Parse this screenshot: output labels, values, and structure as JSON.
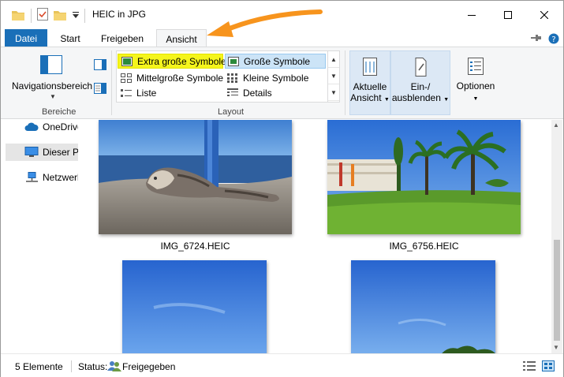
{
  "window": {
    "title": "HEIC in JPG"
  },
  "tabs": [
    {
      "label": "Datei"
    },
    {
      "label": "Start"
    },
    {
      "label": "Freigeben"
    },
    {
      "label": "Ansicht"
    }
  ],
  "ribbon": {
    "panes": {
      "navigation_label": "Navigationsbereich",
      "group_label": "Bereiche"
    },
    "layout": {
      "group_label": "Layout",
      "options": [
        {
          "label": "Extra große Symbole",
          "icon": "extra-large-icons-icon"
        },
        {
          "label": "Große Symbole",
          "icon": "large-icons-icon"
        },
        {
          "label": "Mittelgroße Symbole",
          "icon": "medium-icons-icon"
        },
        {
          "label": "Kleine Symbole",
          "icon": "small-icons-icon"
        },
        {
          "label": "Liste",
          "icon": "list-icon"
        },
        {
          "label": "Details",
          "icon": "details-icon"
        }
      ],
      "highlight_color": "#f5f51c",
      "selected_color": "#cce4f7"
    },
    "current_view": {
      "line1": "Aktuelle",
      "line2": "Ansicht"
    },
    "show_hide": {
      "line1": "Ein-/",
      "line2": "ausblenden"
    },
    "options": {
      "label": "Optionen"
    }
  },
  "nav": {
    "items": [
      {
        "label": "OneDrive",
        "icon": "onedrive-icon"
      },
      {
        "label": "Dieser PC",
        "icon": "computer-icon"
      },
      {
        "label": "Netzwerk",
        "icon": "network-icon"
      }
    ]
  },
  "files": [
    {
      "name": "IMG_6724.HEIC"
    },
    {
      "name": "IMG_6756.HEIC"
    },
    {
      "name": ""
    },
    {
      "name": ""
    }
  ],
  "status": {
    "count": "5 Elemente",
    "label": "Status:",
    "shared": "Freigegeben"
  },
  "colors": {
    "accent": "#1a6fb8",
    "annotation": "#f7941d"
  }
}
